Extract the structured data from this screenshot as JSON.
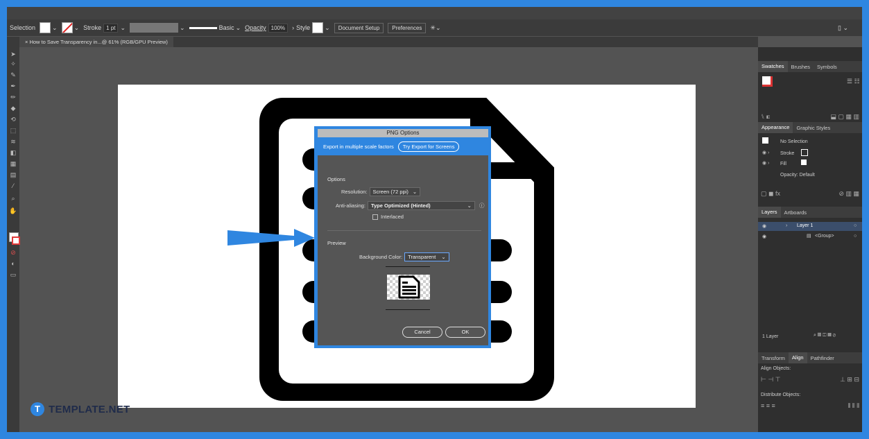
{
  "control_bar": {
    "mode_label": "Selection",
    "stroke_label": "Stroke",
    "stroke_value": "1 pt",
    "stroke_style": "Basic",
    "opacity_label": "Opacity",
    "opacity_value": "100%",
    "style_label": "Style",
    "document_setup": "Document Setup",
    "preferences": "Preferences"
  },
  "document_tab": {
    "label": "How to Save Transparency in...@ 61% (RGB/GPU Preview)"
  },
  "dialog": {
    "title": "PNG Options",
    "banner_text": "Export in multiple scale factors",
    "banner_button": "Try Export for Screens",
    "options_section": "Options",
    "resolution_label": "Resolution",
    "resolution_value": "Screen (72 ppi)",
    "antialias_label": "Anti-aliasing",
    "antialias_value": "Type Optimized (Hinted)",
    "interlaced_label": "Interlaced",
    "preview_section": "Preview",
    "bg_label": "Background Color",
    "bg_value": "Transparent",
    "cancel": "Cancel",
    "ok": "OK"
  },
  "panels": {
    "swatches_tabs": [
      "Swatches",
      "Brushes",
      "Symbols"
    ],
    "appearance_tabs": [
      "Appearance",
      "Graphic Styles"
    ],
    "no_selection": "No Selection",
    "stroke_row": "Stroke",
    "fill_row": "Fill",
    "opacity_row": "Opacity: Default",
    "layers_tabs": [
      "Layers",
      "Artboards"
    ],
    "layer_name": "Layer 1",
    "sublayer_name": "<Group>",
    "layer_count": "1 Layer",
    "align_tabs": [
      "Transform",
      "Align",
      "Pathfinder"
    ],
    "align_objects": "Align Objects:",
    "distribute_objects": "Distribute Objects:"
  },
  "watermark": {
    "logo_letter": "T",
    "brand": "TEMPLATE.NET"
  }
}
